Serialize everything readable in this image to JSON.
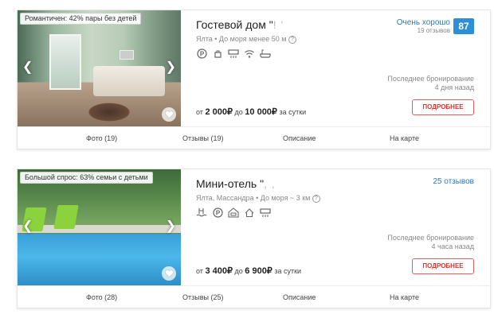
{
  "listings": [
    {
      "badge": "Романтичен: 42% пары без детей",
      "title_prefix": "Гостевой дом \"",
      "title_masked": "!      '",
      "location": "Ялта • До моря менее 50 м",
      "help_icon": "?",
      "amenities": [
        "parking-icon",
        "kettle-icon",
        "air-conditioner-icon",
        "wifi-icon",
        "bathtub-icon"
      ],
      "rating_text": "Очень хорошо",
      "reviews_count": "19 отзывов",
      "score": "87",
      "last_booking_label": "Последнее бронирование",
      "last_booking_time": "4 дня назад",
      "price_from": "от",
      "price_min": "2 000₽",
      "price_to": "до",
      "price_max": "10 000₽",
      "price_period": "за сутки",
      "details_button": "ПОДРОБНЕЕ",
      "tabs": [
        "Фото (19)",
        "Отзывы (19)",
        "Описание",
        "На карте"
      ]
    },
    {
      "badge": "Большой спрос: 63% семьи с детьми",
      "title_prefix": "Мини-отель \"",
      "title_masked": ",      ,",
      "location": "Ялта, Массандра • До моря ~ 3 км",
      "help_icon": "?",
      "amenities": [
        "pool-icon",
        "parking-icon",
        "car-rental-icon",
        "house-icon",
        "air-conditioner-icon"
      ],
      "reviews_link": "25 отзывов",
      "last_booking_label": "Последнее бронирование",
      "last_booking_time": "4 часа назад",
      "price_from": "от",
      "price_min": "3 400₽",
      "price_to": "до",
      "price_max": "6 900₽",
      "price_period": "за сутки",
      "details_button": "ПОДРОБНЕЕ",
      "tabs": [
        "Фото (28)",
        "Отзывы (25)",
        "Описание",
        "На карте"
      ]
    }
  ],
  "icons": {
    "prev_arrow": "❮",
    "next_arrow": "❯",
    "favorite": "heart-icon"
  },
  "colors": {
    "accent_blue": "#2b7bb9",
    "score_bg": "#2d8fd5",
    "button_red": "#e35a5a"
  }
}
